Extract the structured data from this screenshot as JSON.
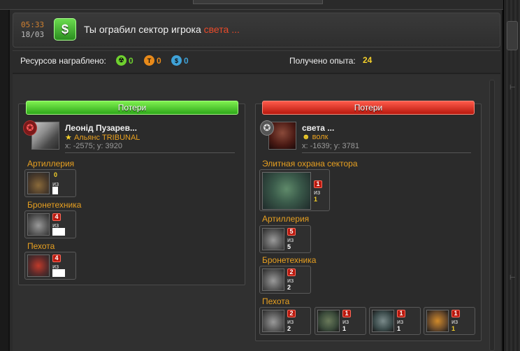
{
  "header": {
    "time": "05:33",
    "date": "18/03",
    "icon": "dollar-icon",
    "message_prefix": "Ты ограбил сектор игрока",
    "message_player": "света ..."
  },
  "summary": {
    "resources_label": "Ресурсов награблено:",
    "resources": [
      {
        "icon": "radiation-icon",
        "glyph": "☢",
        "value": "0",
        "color": "#6fd12f"
      },
      {
        "icon": "titanium-icon",
        "glyph": "T",
        "value": "0",
        "color": "#e88a1a"
      },
      {
        "icon": "credits-icon",
        "glyph": "$",
        "value": "0",
        "color": "#3fa2d8"
      }
    ],
    "exp_label": "Получено опыта:",
    "exp_value": "24"
  },
  "left": {
    "ribbon": "Потери",
    "player": {
      "name": "Леонід Пузарев...",
      "alliance": "Альянс TRIBUNAL",
      "coords": "x: -2575; y: 3920"
    },
    "categories": [
      {
        "label": "Артиллерия",
        "units": [
          {
            "lost": "0",
            "of": "из",
            "total": ""
          }
        ]
      },
      {
        "label": "Бронетехника",
        "units": [
          {
            "lost": "4",
            "of": "из",
            "total": ""
          }
        ]
      },
      {
        "label": "Пехота",
        "units": [
          {
            "lost": "4",
            "of": "из",
            "total": ""
          }
        ]
      }
    ]
  },
  "right": {
    "ribbon": "Потери",
    "player": {
      "name": "света ...",
      "alliance": "волк",
      "coords": "x: -1639; y: 3781"
    },
    "categories": [
      {
        "label": "Элитная охрана сектора",
        "units": [
          {
            "lost": "1",
            "of": "из",
            "total": "1"
          }
        ]
      },
      {
        "label": "Артиллерия",
        "units": [
          {
            "lost": "5",
            "of": "из",
            "total": "5"
          }
        ]
      },
      {
        "label": "Бронетехника",
        "units": [
          {
            "lost": "2",
            "of": "из",
            "total": "2"
          }
        ]
      },
      {
        "label": "Пехота",
        "units": [
          {
            "lost": "2",
            "of": "из",
            "total": "2"
          },
          {
            "lost": "1",
            "of": "из",
            "total": "1"
          },
          {
            "lost": "1",
            "of": "из",
            "total": "1"
          },
          {
            "lost": "1",
            "of": "из",
            "total": "1"
          }
        ]
      }
    ]
  },
  "colors": {
    "accent_orange": "#e8a020",
    "loss_red": "#b8180e",
    "win_green": "#2ea81a",
    "highlight_yellow": "#f5d02a"
  }
}
